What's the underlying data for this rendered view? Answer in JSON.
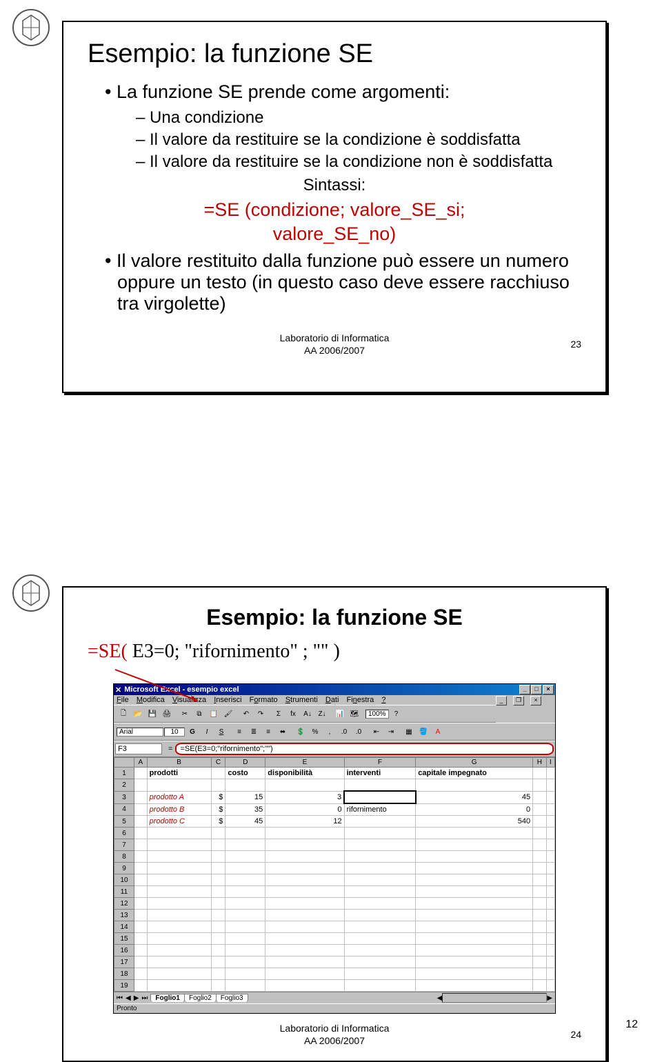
{
  "page_number": "12",
  "logo_alt": "university-seal",
  "slide1": {
    "title": "Esempio: la funzione SE",
    "b1": "La funzione SE prende come argomenti:",
    "b1_1": "Una condizione",
    "b1_2": "Il valore da restituire se la condizione è soddisfatta",
    "b1_3": "Il valore da restituire se la condizione non è soddisfatta",
    "sintassi": "Sintassi:",
    "formula1": "=SE (condizione; valore_SE_si;",
    "formula2": "valore_SE_no)",
    "b2": "Il valore restituito dalla funzione può essere un numero oppure un testo (in questo caso deve essere racchiuso tra virgolette)",
    "footer_center_1": "Laboratorio di Informatica",
    "footer_center_2": "AA 2006/2007",
    "slide_num": "23"
  },
  "slide2": {
    "title": "Esempio: la funzione SE",
    "formula_pre": "=SE(",
    "formula_mid": "  E3=0; \"rifornimento\" ; \"\" )",
    "excel": {
      "window_title": "Microsoft Excel - esempio excel",
      "menu": [
        "File",
        "Modifica",
        "Visualizza",
        "Inserisci",
        "Formato",
        "Strumenti",
        "Dati",
        "Finestra",
        "?"
      ],
      "zoom": "100%",
      "font_name": "Arial",
      "font_size": "10",
      "cell_ref": "F3",
      "formula_bar": "=SE(E3=0;\"rifornimento\";\"\")",
      "col_headers": [
        "A",
        "B",
        "C",
        "D",
        "E",
        "F",
        "G",
        "H",
        "I"
      ],
      "rows_shown": 19,
      "header_row": {
        "B": "prodotti",
        "D": "costo",
        "E": "disponibilità",
        "F": "interventi",
        "G": "capitale impegnato"
      },
      "data": [
        {
          "row": 3,
          "B": "prodotto A",
          "C": "$",
          "D": "15",
          "E": "3",
          "F": "",
          "G": "45"
        },
        {
          "row": 4,
          "B": "prodotto B",
          "C": "$",
          "D": "35",
          "E": "0",
          "F": "rifornimento",
          "G": "0"
        },
        {
          "row": 5,
          "B": "prodotto C",
          "C": "$",
          "D": "45",
          "E": "12",
          "F": "",
          "G": "540"
        }
      ],
      "selected_cell": "F3",
      "sheet_tabs": [
        "Foglio1",
        "Foglio2",
        "Foglio3"
      ],
      "active_tab": "Foglio1",
      "status": "Pronto"
    },
    "footer_center_1": "Laboratorio di Informatica",
    "footer_center_2": "AA 2006/2007",
    "slide_num": "24"
  }
}
